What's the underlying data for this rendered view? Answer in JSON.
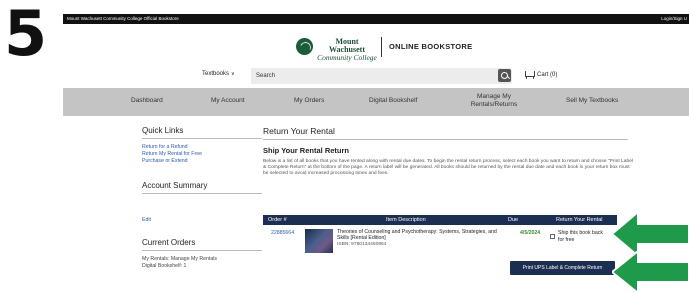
{
  "step": {
    "number": "5"
  },
  "topbar": {
    "left_text": "Mount Wachusett Community College Official Bookstore",
    "right_text": "Login/Sign U"
  },
  "brand": {
    "college_line1": "Mount Wachusett",
    "college_line2": "Community College",
    "store_name": "ONLINE BOOKSTORE"
  },
  "search": {
    "textbooks_label": "Textbooks",
    "placeholder": "Search",
    "cart_label": "Cart (0)"
  },
  "nav": {
    "items": [
      "Dashboard",
      "My Account",
      "My Orders",
      "Digital Bookshelf",
      "Manage My Rentals/Returns",
      "Sell My Textbooks"
    ]
  },
  "sidebar": {
    "quick_links_title": "Quick Links",
    "quick_links": [
      "Return for a Refund",
      "Return My Rental for Free",
      "Purchase or Extend"
    ],
    "account_summary_title": "Account Summary",
    "edit_label": "Edit",
    "current_orders_title": "Current Orders",
    "current_orders": [
      "My Rentals: Manage My Rentals",
      "Digital Bookshelf: 1"
    ]
  },
  "main": {
    "title": "Return Your Rental",
    "subtitle": "Ship Your Rental Return",
    "description": "Below is a list of all books that you have rented along with rental due dates. To begin the rental return process, select each book you want to return and choose \"Print Label & Complete Return\" at the bottom of the page. A return label will be generated. All books should be returned by the rental due date and each book in your return box must be selected to avoid increased processing times and fees."
  },
  "table": {
    "headers": {
      "order": "Order #",
      "description": "Item Description",
      "due": "Due",
      "return": "Return Your Rental"
    },
    "rows": [
      {
        "order": "22885664",
        "title": "Theories of Counseling and Psychotherapy: Systems, Strategies, and Skills [Rental Edition]",
        "isbn": "ISBN: 9780134460864",
        "due": "4/5/2024",
        "ship_label": "Ship this book back for free",
        "checked": false
      }
    ]
  },
  "actions": {
    "print_label": "Print UPS Label & Complete Return"
  },
  "colors": {
    "nav_bg": "#c4c4c4",
    "table_header": "#1c2f52",
    "link": "#2a5db0",
    "due_green": "#3d8a2f",
    "arrow_green": "#1f9a4a",
    "brand_green": "#1d4d34"
  }
}
